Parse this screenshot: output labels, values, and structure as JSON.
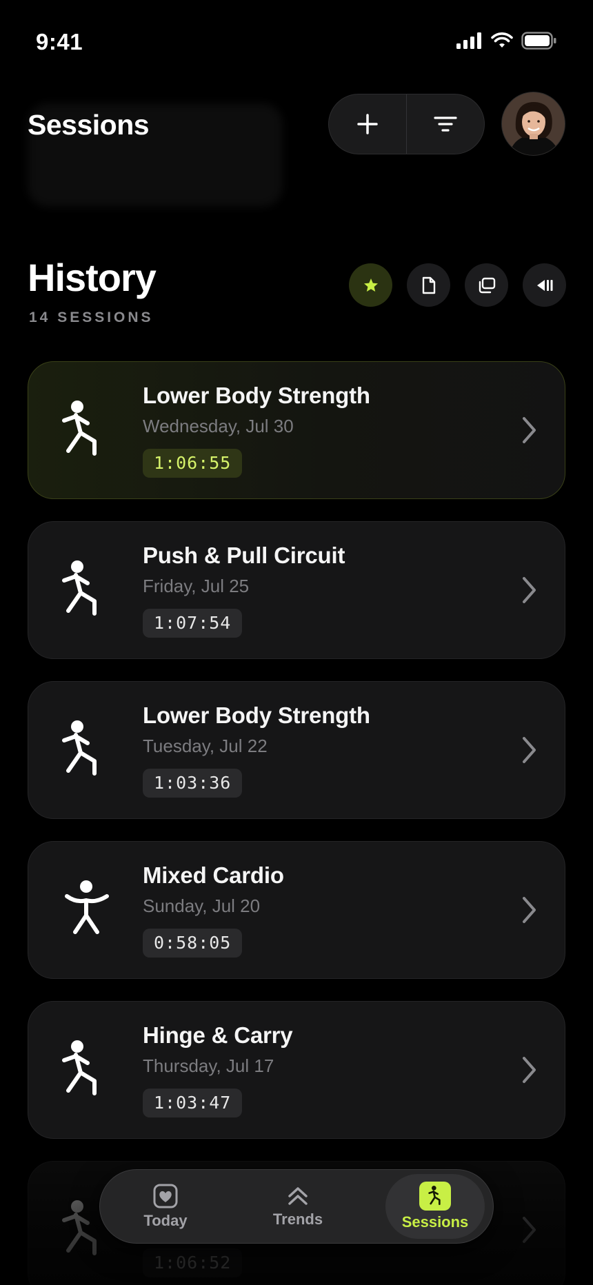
{
  "status_bar": {
    "time": "9:41"
  },
  "header": {
    "title": "Sessions"
  },
  "history": {
    "title": "History",
    "subtitle": "14 SESSIONS"
  },
  "sessions": [
    {
      "title": "Lower Body Strength",
      "date": "Wednesday, Jul 30",
      "duration": "1:06:55",
      "icon": "running-figure-icon",
      "highlighted": true
    },
    {
      "title": "Push & Pull Circuit",
      "date": "Friday, Jul 25",
      "duration": "1:07:54",
      "icon": "running-figure-icon",
      "highlighted": false
    },
    {
      "title": "Lower Body Strength",
      "date": "Tuesday, Jul 22",
      "duration": "1:03:36",
      "icon": "running-figure-icon",
      "highlighted": false
    },
    {
      "title": "Mixed Cardio",
      "date": "Sunday, Jul 20",
      "duration": "0:58:05",
      "icon": "jumping-figure-icon",
      "highlighted": false
    },
    {
      "title": "Hinge & Carry",
      "date": "Thursday, Jul 17",
      "duration": "1:03:47",
      "icon": "running-figure-icon",
      "highlighted": false
    },
    {
      "title": "",
      "date": "",
      "duration": "1:06:52",
      "icon": "running-figure-icon",
      "highlighted": false
    }
  ],
  "tabbar": {
    "tabs": [
      {
        "label": "Today",
        "icon": "heart-icon"
      },
      {
        "label": "Trends",
        "icon": "chevrons-up-icon"
      },
      {
        "label": "Sessions",
        "icon": "running-figure-icon",
        "active": true
      }
    ]
  },
  "colors": {
    "accent": "#c8ef45",
    "background": "#000000",
    "card": "#161617"
  }
}
